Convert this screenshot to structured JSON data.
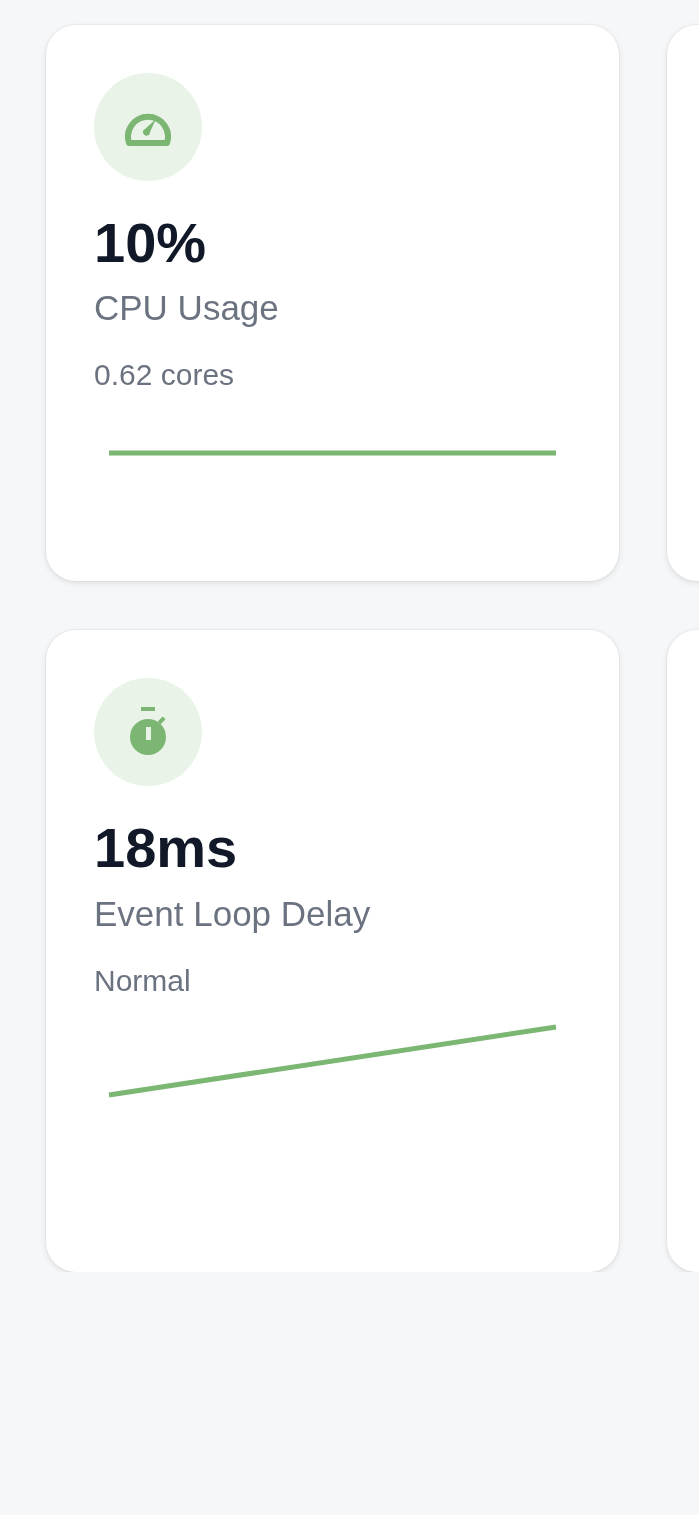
{
  "metrics": [
    {
      "kind": "cpu",
      "value": "10%",
      "label": "CPU Usage",
      "detail": "0.62 cores"
    },
    {
      "kind": "latency",
      "value": "18ms",
      "label": "Event Loop Delay",
      "detail": "Normal"
    }
  ]
}
